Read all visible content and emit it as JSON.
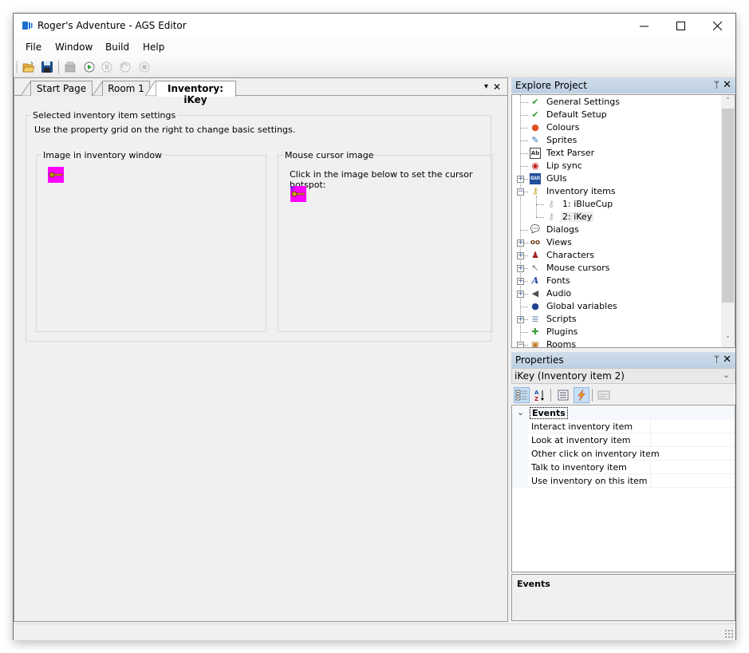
{
  "window": {
    "title": "Roger's Adventure - AGS Editor",
    "controls": {
      "minimize": "—",
      "maximize": "☐",
      "close": "✕"
    }
  },
  "menu": [
    "File",
    "Window",
    "Build",
    "Help"
  ],
  "toolbar": {
    "buttons": [
      {
        "name": "open-project-icon",
        "enabled": true
      },
      {
        "name": "save-icon",
        "enabled": true
      },
      {
        "name": "build-exe-icon",
        "enabled": false
      },
      {
        "name": "run-icon",
        "enabled": true
      },
      {
        "name": "pause-icon",
        "enabled": false
      },
      {
        "name": "step-icon",
        "enabled": false
      },
      {
        "name": "stop-icon",
        "enabled": false
      }
    ]
  },
  "tabs": [
    {
      "label": "Start Page",
      "active": false
    },
    {
      "label": "Room 1",
      "active": false
    },
    {
      "label": "Inventory: iKey",
      "active": true
    }
  ],
  "tabstrip": {
    "dropdown": "▾",
    "close": "✕"
  },
  "inventory_editor": {
    "settings_group": "Selected inventory item settings",
    "settings_hint": "Use the property grid on the right to change basic settings.",
    "image_group": "Image in inventory window",
    "cursor_group": "Mouse cursor image",
    "cursor_hint": "Click in the image below to set the cursor hotspot:",
    "sprite_bg_color": "#ff00ff"
  },
  "explorer": {
    "title": "Explore Project",
    "pin": "ᛘ",
    "close": "✕",
    "items": [
      {
        "label": "General Settings",
        "icon": "checkmark-icon",
        "glyph": "✔",
        "expander": ""
      },
      {
        "label": "Default Setup",
        "icon": "checkmark-icon",
        "glyph": "✔",
        "expander": ""
      },
      {
        "label": "Colours",
        "icon": "colour-wheel-icon",
        "glyph": "●",
        "expander": ""
      },
      {
        "label": "Sprites",
        "icon": "sprite-feather-icon",
        "glyph": "✎",
        "expander": ""
      },
      {
        "label": "Text Parser",
        "icon": "text-parser-icon",
        "glyph": "Ab",
        "expander": ""
      },
      {
        "label": "Lip sync",
        "icon": "lips-icon",
        "glyph": "◉",
        "expander": ""
      },
      {
        "label": "GUIs",
        "icon": "gui-icon",
        "glyph": "GUI",
        "expander": "+"
      },
      {
        "label": "Inventory items",
        "icon": "key-icon",
        "glyph": "⚷",
        "expander": "−"
      },
      {
        "label": "1: iBlueCup",
        "icon": "inventory-item-icon",
        "glyph": "⚷",
        "expander": "",
        "child": true
      },
      {
        "label": "2: iKey",
        "icon": "inventory-item-icon",
        "glyph": "⚷",
        "expander": "",
        "child": true,
        "selected": true
      },
      {
        "label": "Dialogs",
        "icon": "speech-bubble-icon",
        "glyph": "💬",
        "expander": ""
      },
      {
        "label": "Views",
        "icon": "glasses-icon",
        "glyph": "oo",
        "expander": "+"
      },
      {
        "label": "Characters",
        "icon": "characters-icon",
        "glyph": "♟",
        "expander": "+"
      },
      {
        "label": "Mouse cursors",
        "icon": "mouse-cursor-icon",
        "glyph": "↖",
        "expander": "+"
      },
      {
        "label": "Fonts",
        "icon": "font-icon",
        "glyph": "A",
        "expander": "+"
      },
      {
        "label": "Audio",
        "icon": "speaker-icon",
        "glyph": "◀",
        "expander": "+"
      },
      {
        "label": "Global variables",
        "icon": "globe-icon",
        "glyph": "●",
        "expander": ""
      },
      {
        "label": "Scripts",
        "icon": "script-scroll-icon",
        "glyph": "≣",
        "expander": "+"
      },
      {
        "label": "Plugins",
        "icon": "puzzle-piece-icon",
        "glyph": "✚",
        "expander": ""
      },
      {
        "label": "Rooms",
        "icon": "rooms-icon",
        "glyph": "▣",
        "expander": "−"
      }
    ],
    "scroll": {
      "up": "˄",
      "down": "˅",
      "position": 0.0
    }
  },
  "properties": {
    "title": "Properties",
    "pin": "ᛘ",
    "close": "✕",
    "selected_object": "iKey (Inventory item 2)",
    "combo_arrow": "⌄",
    "category": {
      "label": "Events",
      "chevron": "⌄"
    },
    "rows": [
      {
        "name": "Interact inventory item",
        "value": ""
      },
      {
        "name": "Look at inventory item",
        "value": ""
      },
      {
        "name": "Other click on inventory item",
        "value": ""
      },
      {
        "name": "Talk to inventory item",
        "value": ""
      },
      {
        "name": "Use inventory on this item",
        "value": ""
      }
    ],
    "help_title": "Events",
    "help_text": ""
  }
}
